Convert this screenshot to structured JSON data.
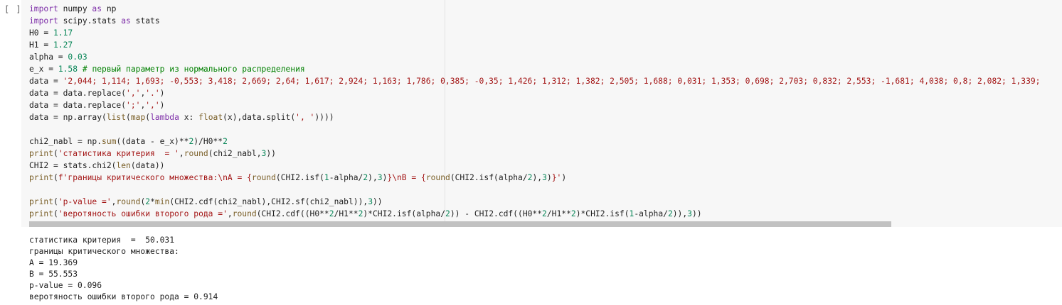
{
  "cell": {
    "run_indicator": "[ ]",
    "code_lines": [
      [
        {
          "t": "import",
          "c": "kw"
        },
        {
          "t": " numpy "
        },
        {
          "t": "as",
          "c": "kw"
        },
        {
          "t": " np"
        }
      ],
      [
        {
          "t": "import",
          "c": "kw"
        },
        {
          "t": " scipy.stats "
        },
        {
          "t": "as",
          "c": "kw"
        },
        {
          "t": " stats"
        }
      ],
      [
        {
          "t": "H0 = "
        },
        {
          "t": "1.17",
          "c": "num"
        }
      ],
      [
        {
          "t": "H1 = "
        },
        {
          "t": "1.27",
          "c": "num"
        }
      ],
      [
        {
          "t": "alpha = "
        },
        {
          "t": "0.03",
          "c": "num"
        }
      ],
      [
        {
          "t": "e_x = "
        },
        {
          "t": "1.58",
          "c": "num"
        },
        {
          "t": " "
        },
        {
          "t": "# первый параметр из нормального распределения",
          "c": "com"
        }
      ],
      [
        {
          "t": "data = "
        },
        {
          "t": "'2,044; 1,114; 1,693; -0,553; 3,418; 2,669; 2,64; 1,617; 2,924; 1,163; 1,786; 0,385; -0,35; 1,426; 1,312; 1,382; 2,505; 1,688; 0,031; 1,353; 0,698; 2,703; 0,832; 2,553; -1,681; 4,038; 0,8; 2,082; 1,339;",
          "c": "str"
        }
      ],
      [
        {
          "t": "data = data.replace("
        },
        {
          "t": "','",
          "c": "str"
        },
        {
          "t": ","
        },
        {
          "t": "'.'",
          "c": "str"
        },
        {
          "t": ")"
        }
      ],
      [
        {
          "t": "data = data.replace("
        },
        {
          "t": "';'",
          "c": "str"
        },
        {
          "t": ","
        },
        {
          "t": "','",
          "c": "str"
        },
        {
          "t": ")"
        }
      ],
      [
        {
          "t": "data = np.array("
        },
        {
          "t": "list",
          "c": "fn"
        },
        {
          "t": "("
        },
        {
          "t": "map",
          "c": "fn"
        },
        {
          "t": "("
        },
        {
          "t": "lambda",
          "c": "kw"
        },
        {
          "t": " x: "
        },
        {
          "t": "float",
          "c": "fn"
        },
        {
          "t": "(x),data.split("
        },
        {
          "t": "', '",
          "c": "str"
        },
        {
          "t": "))))"
        }
      ],
      [],
      [
        {
          "t": "chi2_nabl = np."
        },
        {
          "t": "sum",
          "c": "fn"
        },
        {
          "t": "((data - e_x)**"
        },
        {
          "t": "2",
          "c": "num"
        },
        {
          "t": ")/H0**"
        },
        {
          "t": "2",
          "c": "num"
        }
      ],
      [
        {
          "t": "print",
          "c": "fn"
        },
        {
          "t": "("
        },
        {
          "t": "'статистика критерия  = '",
          "c": "str"
        },
        {
          "t": ","
        },
        {
          "t": "round",
          "c": "fn"
        },
        {
          "t": "(chi2_nabl,"
        },
        {
          "t": "3",
          "c": "num"
        },
        {
          "t": "))"
        }
      ],
      [
        {
          "t": "CHI2 = stats.chi2("
        },
        {
          "t": "len",
          "c": "fn"
        },
        {
          "t": "(data))"
        }
      ],
      [
        {
          "t": "print",
          "c": "fn"
        },
        {
          "t": "("
        },
        {
          "t": "f'границы критического множества:\\nA = {",
          "c": "str"
        },
        {
          "t": "round",
          "c": "fn"
        },
        {
          "t": "(CHI2.isf("
        },
        {
          "t": "1",
          "c": "num"
        },
        {
          "t": "-alpha/"
        },
        {
          "t": "2",
          "c": "num"
        },
        {
          "t": "),"
        },
        {
          "t": "3",
          "c": "num"
        },
        {
          "t": ")"
        },
        {
          "t": "}\\nB = {",
          "c": "str"
        },
        {
          "t": "round",
          "c": "fn"
        },
        {
          "t": "(CHI2.isf(alpha/"
        },
        {
          "t": "2",
          "c": "num"
        },
        {
          "t": "),"
        },
        {
          "t": "3",
          "c": "num"
        },
        {
          "t": ")"
        },
        {
          "t": "}'",
          "c": "str"
        },
        {
          "t": ")"
        }
      ],
      [],
      [
        {
          "t": "print",
          "c": "fn"
        },
        {
          "t": "("
        },
        {
          "t": "'p-value ='",
          "c": "str"
        },
        {
          "t": ","
        },
        {
          "t": "round",
          "c": "fn"
        },
        {
          "t": "("
        },
        {
          "t": "2",
          "c": "num"
        },
        {
          "t": "*"
        },
        {
          "t": "min",
          "c": "fn"
        },
        {
          "t": "(CHI2.cdf(chi2_nabl),CHI2.sf(chi2_nabl)),"
        },
        {
          "t": "3",
          "c": "num"
        },
        {
          "t": "))"
        }
      ],
      [
        {
          "t": "print",
          "c": "fn"
        },
        {
          "t": "("
        },
        {
          "t": "'веротяность ошибки второго рода ='",
          "c": "str"
        },
        {
          "t": ","
        },
        {
          "t": "round",
          "c": "fn"
        },
        {
          "t": "(CHI2.cdf((H0**"
        },
        {
          "t": "2",
          "c": "num"
        },
        {
          "t": "/H1**"
        },
        {
          "t": "2",
          "c": "num"
        },
        {
          "t": ")*CHI2.isf(alpha/"
        },
        {
          "t": "2",
          "c": "num"
        },
        {
          "t": ")) - CHI2.cdf((H0**"
        },
        {
          "t": "2",
          "c": "num"
        },
        {
          "t": "/H1**"
        },
        {
          "t": "2",
          "c": "num"
        },
        {
          "t": ")*CHI2.isf("
        },
        {
          "t": "1",
          "c": "num"
        },
        {
          "t": "-alpha/"
        },
        {
          "t": "2",
          "c": "num"
        },
        {
          "t": ")),"
        },
        {
          "t": "3",
          "c": "num"
        },
        {
          "t": "))"
        }
      ]
    ],
    "output_lines": [
      "статистика критерия  =  50.031",
      "границы критического множества:",
      "A = 19.369",
      "B = 55.553",
      "p-value = 0.096",
      "веротяность ошибки второго рода = 0.914"
    ]
  },
  "colors": {
    "keyword": "#7d2ea8",
    "number": "#098658",
    "string": "#a31515",
    "comment": "#008000",
    "builtin": "#795e26",
    "code_background": "#f7f7f7",
    "scrollbar": "#c1c1c1"
  }
}
